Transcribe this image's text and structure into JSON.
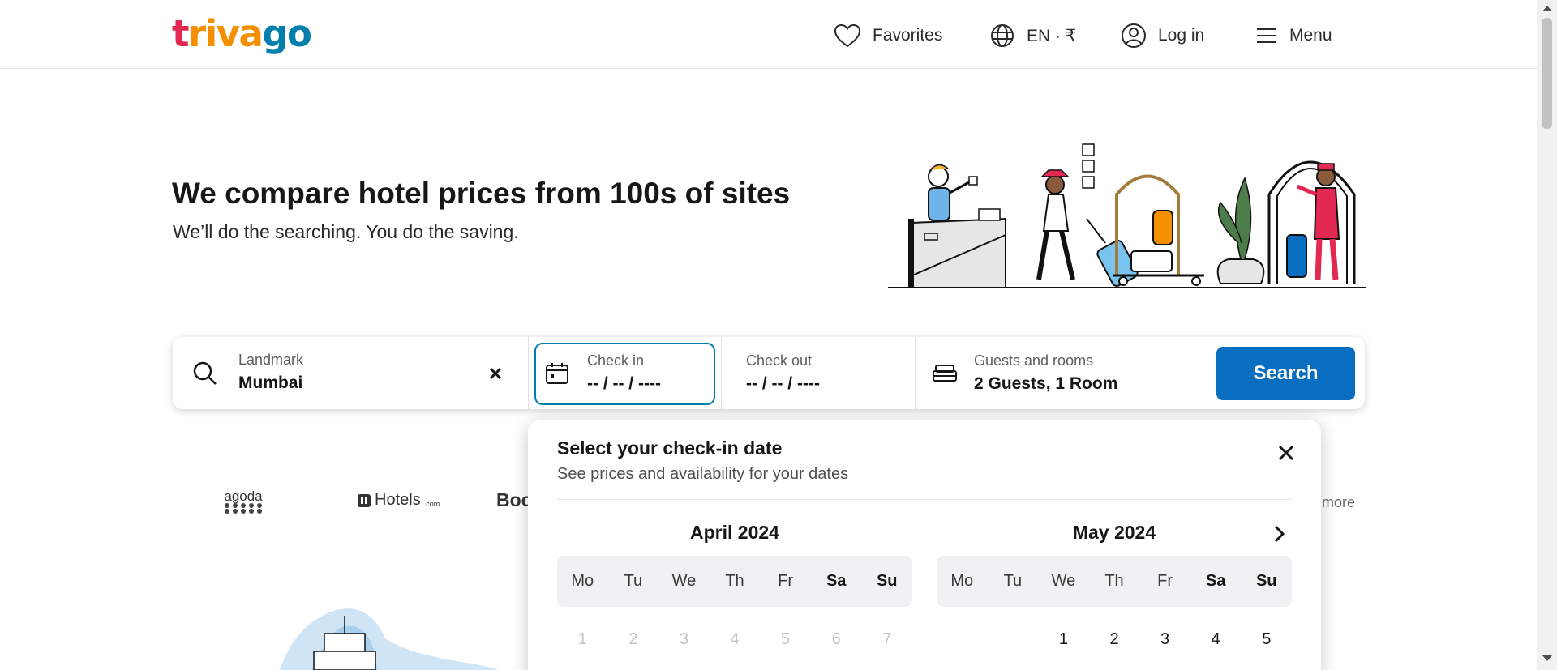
{
  "header": {
    "logo": [
      "t",
      "ri",
      "va",
      "go"
    ],
    "favorites_label": "Favorites",
    "language_label": "EN · ₹",
    "login_label": "Log in",
    "menu_label": "Menu"
  },
  "hero": {
    "title": "We compare hotel prices from 100s of sites",
    "subtitle": "We’ll do the searching. You do the saving."
  },
  "search": {
    "destination_label": "Landmark",
    "destination_value": "Mumbai",
    "checkin_label": "Check in",
    "checkin_value": "-- / -- / ----",
    "checkout_label": "Check out",
    "checkout_value": "-- / -- / ----",
    "guests_label": "Guests and rooms",
    "guests_value": "2 Guests, 1 Room",
    "search_button": "Search"
  },
  "partners": {
    "items": [
      "agoda",
      "Hotels",
      ".com",
      "Boo"
    ],
    "more_label": "more"
  },
  "datepicker": {
    "title": "Select your check-in date",
    "subtitle": "See prices and availability for your dates",
    "weekdays": [
      "Mo",
      "Tu",
      "We",
      "Th",
      "Fr",
      "Sa",
      "Su"
    ],
    "months": [
      {
        "title": "April 2024",
        "first_row": [
          "1",
          "2",
          "3",
          "4",
          "5",
          "6",
          "7"
        ]
      },
      {
        "title": "May 2024",
        "first_row": [
          "",
          "",
          "1",
          "2",
          "3",
          "4",
          "5"
        ]
      }
    ]
  },
  "colors": {
    "brand_red": "#e32851",
    "brand_orange": "#f48f00",
    "brand_blue": "#007fad",
    "search_button": "#0a6ec0"
  }
}
